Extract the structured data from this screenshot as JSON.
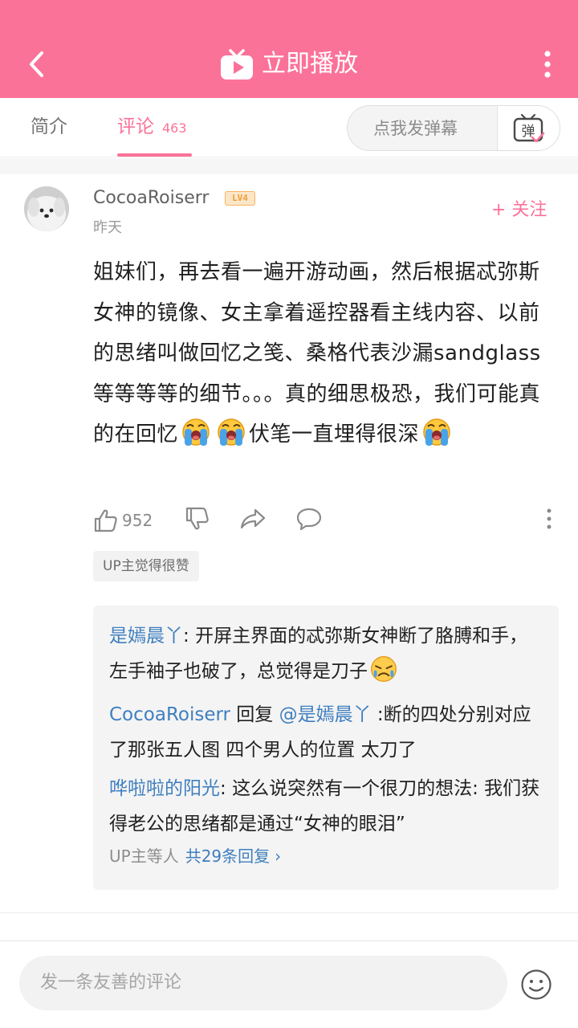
{
  "header": {
    "title": "立即播放",
    "back_icon": "back-arrow-icon",
    "play_icon": "tv-play-icon",
    "more_icon": "more-vertical-icon",
    "bg_color": "#fb7299"
  },
  "tabs": {
    "intro": "简介",
    "comments": "评论",
    "comments_count": "463",
    "active": "评论"
  },
  "danmaku": {
    "placeholder": "点我发弹幕",
    "button_icon": "danmaku-toggle-icon",
    "button_glyph": "弹"
  },
  "comment": {
    "username": "CocoaRoiserr",
    "level": "LV4",
    "time": "昨天",
    "follow": "+ 关注",
    "text_before_emoji": "姐妹们，再去看一遍开游动画，然后根据忒弥斯女神的镜像、女主拿着遥控器看主线内容、以前的思绪叫做回忆之笺、桑格代表沙漏sandglass等等等等的细节。。。真的细思极恐，我们可能真的在回忆",
    "text_between_emoji": "伏笔一直埋得很深",
    "likes": "952",
    "up_badge": "UP主觉得很赞",
    "action_icons": [
      "thumb-up-icon",
      "thumb-down-icon",
      "share-icon",
      "reply-icon",
      "more-vertical-icon"
    ]
  },
  "replies": [
    {
      "user": "是嫣晨丫",
      "sep": ": ",
      "text": "开屏主界面的忒弥斯女神断了胳膊和手，左手袖子也破了，总觉得是刀子"
    },
    {
      "user": "CocoaRoiserr",
      "reply_word": " 回复 ",
      "mention": "@是嫣晨丫",
      "text": " :断的四处分别对应了那张五人图 四个男人的位置 太刀了"
    },
    {
      "user": "哗啦啦的阳光",
      "sep": ": ",
      "text": "这么说突然有一个很刀的想法: 我们获得老公的思绪都是通过“女神的眼泪”"
    }
  ],
  "replies_footer": {
    "who": "UP主等人",
    "total": "共29条回复",
    "chevron": "›"
  },
  "bottom": {
    "placeholder": "发一条友善的评论",
    "emoji_icon": "smiley-icon"
  }
}
